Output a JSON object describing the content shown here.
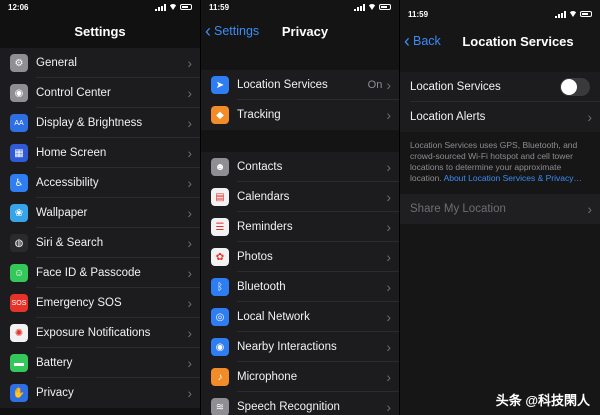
{
  "panel1": {
    "time": "12:06",
    "title": "Settings",
    "items": [
      {
        "label": "General",
        "icon": "gear-icon",
        "color": "#8e8e93",
        "glyph": "⚙"
      },
      {
        "label": "Control Center",
        "icon": "control-center-icon",
        "color": "#8e8e93",
        "glyph": "◉"
      },
      {
        "label": "Display & Brightness",
        "icon": "display-icon",
        "color": "#2f6fe4",
        "glyph": "AA"
      },
      {
        "label": "Home Screen",
        "icon": "home-screen-icon",
        "color": "#2f5bd6",
        "glyph": "▦"
      },
      {
        "label": "Accessibility",
        "icon": "accessibility-icon",
        "color": "#2f7df2",
        "glyph": "♿"
      },
      {
        "label": "Wallpaper",
        "icon": "wallpaper-icon",
        "color": "#37a3e8",
        "glyph": "❀"
      },
      {
        "label": "Siri & Search",
        "icon": "siri-icon",
        "color": "#2a2a2a",
        "glyph": "◍"
      },
      {
        "label": "Face ID & Passcode",
        "icon": "face-id-icon",
        "color": "#34c759",
        "glyph": "☺"
      },
      {
        "label": "Emergency SOS",
        "icon": "sos-icon",
        "color": "#e5332a",
        "glyph": "SOS"
      },
      {
        "label": "Exposure Notifications",
        "icon": "exposure-icon",
        "color": "#f2f2f2",
        "glyph": "✺"
      },
      {
        "label": "Battery",
        "icon": "battery-icon",
        "color": "#34c759",
        "glyph": "▬"
      },
      {
        "label": "Privacy",
        "icon": "hand-icon",
        "color": "#2f6fe4",
        "glyph": "✋"
      }
    ]
  },
  "panel2": {
    "time": "11:59",
    "back": "Settings",
    "title": "Privacy",
    "group1": [
      {
        "label": "Location Services",
        "detail": "On",
        "icon": "location-arrow-icon",
        "color": "#2f7df2",
        "glyph": "➤"
      },
      {
        "label": "Tracking",
        "detail": "",
        "icon": "tracking-icon",
        "color": "#f28c28",
        "glyph": "◆"
      }
    ],
    "group2": [
      {
        "label": "Contacts",
        "icon": "contacts-icon",
        "color": "#8e8e93",
        "glyph": "☻"
      },
      {
        "label": "Calendars",
        "icon": "calendar-icon",
        "color": "#f2f2f2",
        "glyph": "▤"
      },
      {
        "label": "Reminders",
        "icon": "reminders-icon",
        "color": "#f2f2f2",
        "glyph": "☰"
      },
      {
        "label": "Photos",
        "icon": "photos-icon",
        "color": "#f2f2f2",
        "glyph": "✿"
      },
      {
        "label": "Bluetooth",
        "icon": "bluetooth-icon",
        "color": "#2f7df2",
        "glyph": "ᛒ"
      },
      {
        "label": "Local Network",
        "icon": "globe-icon",
        "color": "#2f7df2",
        "glyph": "◎"
      },
      {
        "label": "Nearby Interactions",
        "icon": "nearby-icon",
        "color": "#2f7df2",
        "glyph": "◉"
      },
      {
        "label": "Microphone",
        "icon": "microphone-icon",
        "color": "#f28c28",
        "glyph": "♪"
      },
      {
        "label": "Speech Recognition",
        "icon": "speech-icon",
        "color": "#8e8e93",
        "glyph": "≋"
      }
    ]
  },
  "panel3": {
    "time": "11:59",
    "back": "Back",
    "title": "Location Services",
    "toggle_label": "Location Services",
    "alerts_label": "Location Alerts",
    "description": "Location Services uses GPS, Bluetooth, and crowd-sourced Wi-Fi hotspot and cell tower locations to determine your approximate location. ",
    "description_link": "About Location Services & Privacy…",
    "share_label": "Share My Location"
  },
  "watermark": "头条 @科技閑人"
}
